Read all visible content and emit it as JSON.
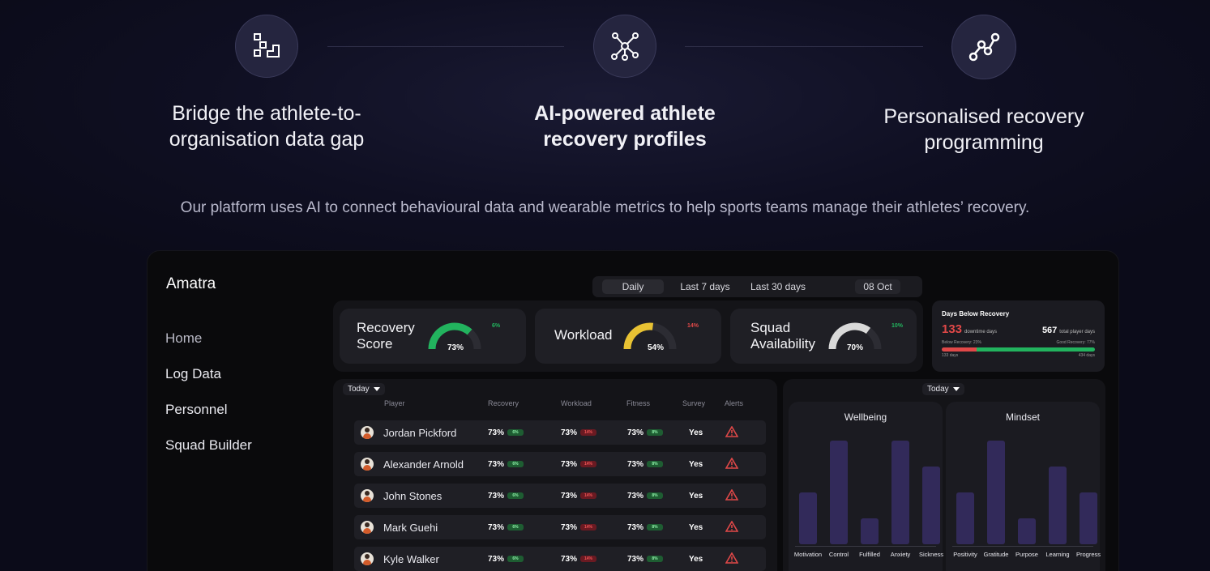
{
  "features": [
    {
      "icon": "steps-icon",
      "title": "Bridge the athlete-to-organisation data gap",
      "line1": "Bridge the athlete-to-",
      "line2": "organisation data gap"
    },
    {
      "icon": "network-icon",
      "title": "AI-powered athlete recovery profiles",
      "line1": "AI-powered athlete",
      "line2": "recovery profiles"
    },
    {
      "icon": "trend-graph-icon",
      "title": "Personalised recovery programming",
      "line1": "Personalised recovery",
      "line2": "programming"
    }
  ],
  "tagline": "Our platform uses AI to connect behavioural data and wearable metrics to help sports teams manage their athletes’ recovery.",
  "app": {
    "brand": "Amatra",
    "nav": [
      "Home",
      "Log Data",
      "Personnel",
      "Squad Builder"
    ],
    "date_tabs": [
      "Daily",
      "Last 7 days",
      "Last 30 days"
    ],
    "date": "08 Oct",
    "kpis": [
      {
        "label_1": "Recovery",
        "label_2": "Score",
        "value": 0.73,
        "value_label": "73%",
        "trend": "up",
        "trend_label": "6%",
        "color": "#22b35e"
      },
      {
        "label_1": "Workload",
        "label_2": "",
        "value": 0.54,
        "value_label": "54%",
        "trend": "down",
        "trend_label": "14%",
        "color": "#e8c233"
      },
      {
        "label_1": "Squad",
        "label_2": "Availability",
        "value": 0.7,
        "value_label": "70%",
        "trend": "up",
        "trend_label": "10%",
        "color": "#d9d9d9"
      }
    ],
    "days_below": {
      "title": "Days Below Recovery",
      "downtime_value": "133",
      "downtime_label": "downtime days",
      "total_value": "567",
      "total_label": "total player days",
      "below_label": "Below Recovery: 23%",
      "good_label": "Good Recovery: 77%",
      "left_small": "133 days",
      "right_small": "434 days",
      "below_fraction": 0.23,
      "below_color": "#e04848",
      "good_color": "#22b35e"
    },
    "table": {
      "filter": "Today",
      "headers": [
        "Player",
        "Recovery",
        "Workload",
        "Fitness",
        "Survey",
        "Alerts"
      ],
      "rows": [
        {
          "name": "Jordan Pickford",
          "recovery": "73%",
          "recovery_chip": "6%",
          "workload": "73%",
          "workload_chip": "14%",
          "fitness": "73%",
          "fitness_chip": "8%",
          "survey": "Yes"
        },
        {
          "name": "Alexander Arnold",
          "recovery": "73%",
          "recovery_chip": "6%",
          "workload": "73%",
          "workload_chip": "14%",
          "fitness": "73%",
          "fitness_chip": "8%",
          "survey": "Yes"
        },
        {
          "name": "John Stones",
          "recovery": "73%",
          "recovery_chip": "6%",
          "workload": "73%",
          "workload_chip": "14%",
          "fitness": "73%",
          "fitness_chip": "8%",
          "survey": "Yes"
        },
        {
          "name": "Mark Guehi",
          "recovery": "73%",
          "recovery_chip": "6%",
          "workload": "73%",
          "workload_chip": "14%",
          "fitness": "73%",
          "fitness_chip": "8%",
          "survey": "Yes"
        },
        {
          "name": "Kyle Walker",
          "recovery": "73%",
          "recovery_chip": "6%",
          "workload": "73%",
          "workload_chip": "14%",
          "fitness": "73%",
          "fitness_chip": "8%",
          "survey": "Yes"
        }
      ]
    },
    "charts_filter": "Today"
  },
  "chart_data": [
    {
      "type": "bar",
      "title": "Wellbeing",
      "categories": [
        "Motivation",
        "Control",
        "Fulfilled",
        "Anxiety",
        "Sickness"
      ],
      "values": [
        2,
        4,
        1,
        4,
        3
      ],
      "ylim": [
        0,
        4
      ]
    },
    {
      "type": "bar",
      "title": "Mindset",
      "categories": [
        "Positivity",
        "Gratitude",
        "Purpose",
        "Learning",
        "Progress"
      ],
      "values": [
        2,
        4,
        1,
        3,
        2
      ],
      "ylim": [
        0,
        4
      ]
    }
  ]
}
